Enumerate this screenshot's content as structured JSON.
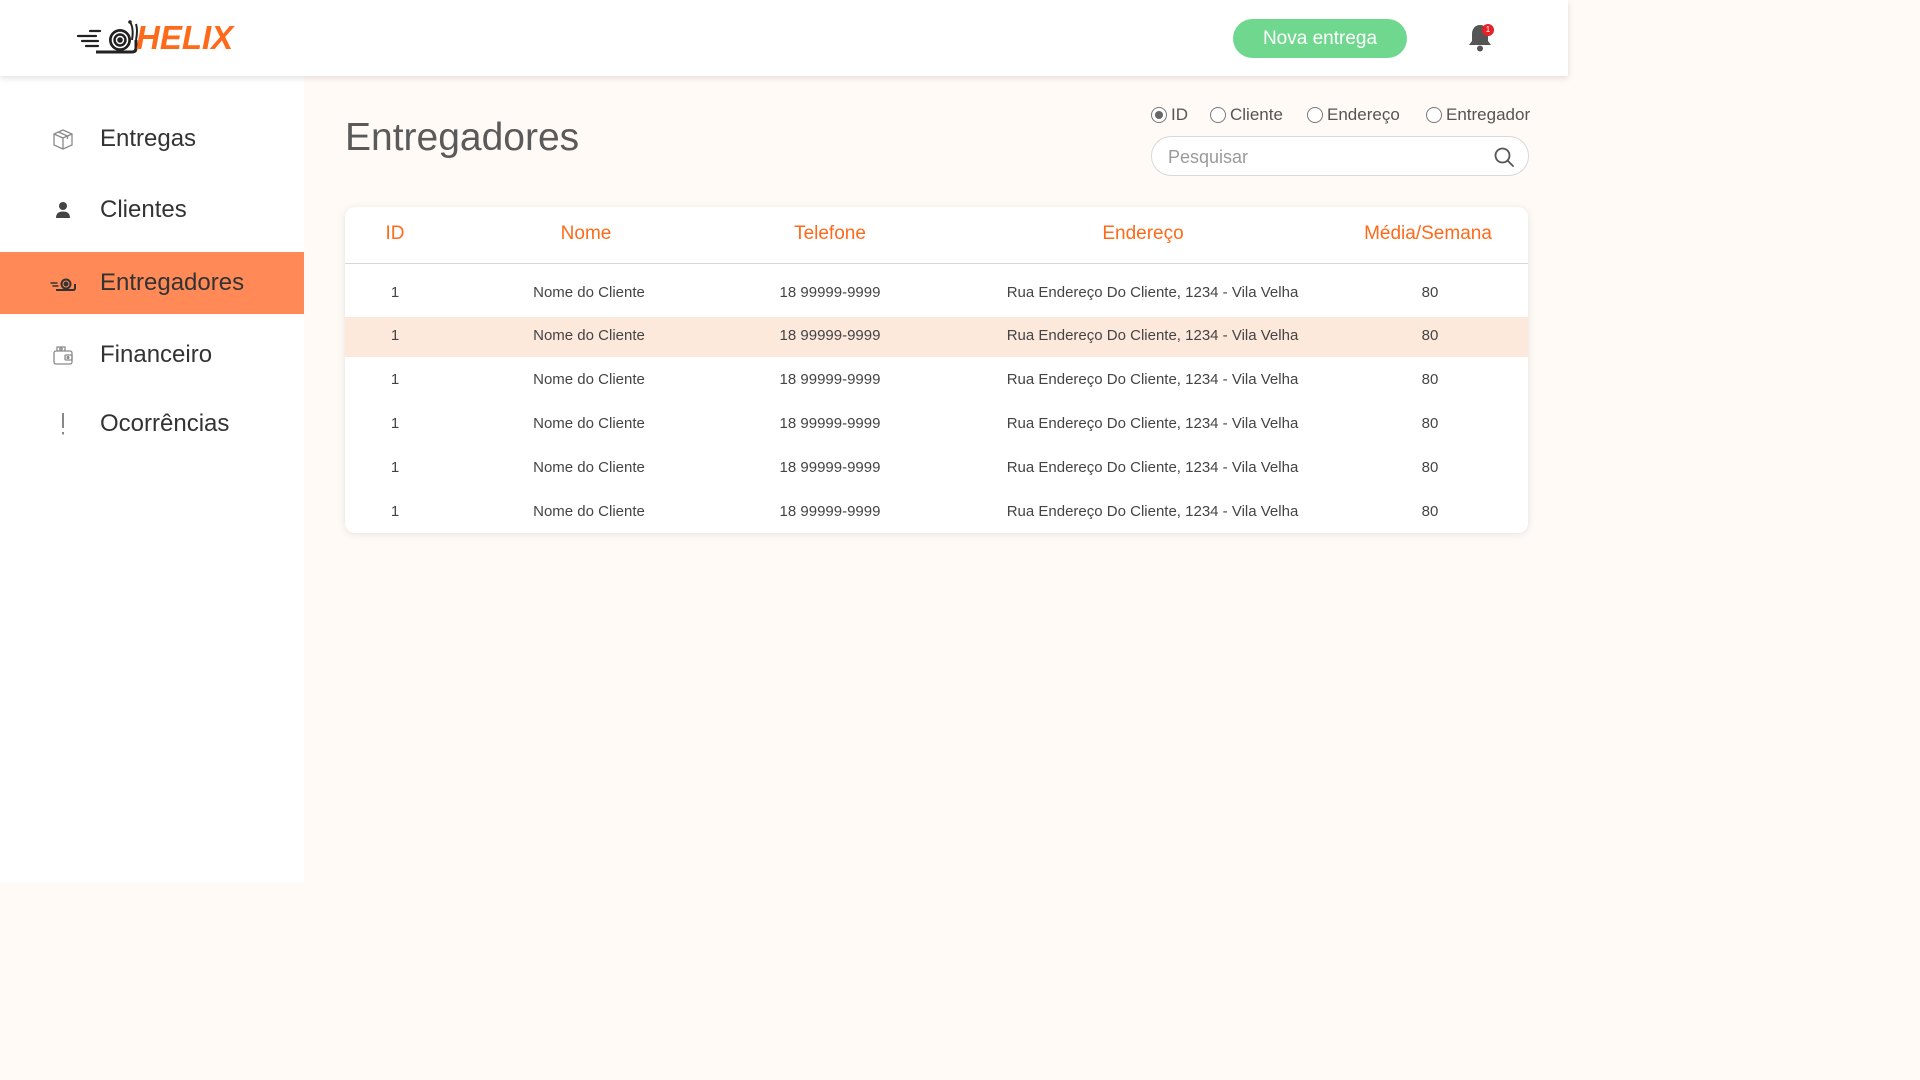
{
  "header": {
    "logo_text": "HELIX",
    "new_button_label": "Nova entrega",
    "notification_count": "1",
    "accent_color": "#ff6a1a",
    "button_color": "#6fd88e"
  },
  "sidebar": {
    "items": [
      {
        "label": "Entregas",
        "icon": "box-icon",
        "active": false
      },
      {
        "label": "Clientes",
        "icon": "person-icon",
        "active": false
      },
      {
        "label": "Entregadores",
        "icon": "snail-icon",
        "active": true
      },
      {
        "label": "Financeiro",
        "icon": "wallet-icon",
        "active": false
      },
      {
        "label": "Ocorrências",
        "icon": "exclamation-icon",
        "active": false
      }
    ],
    "active_color": "#ff8a57"
  },
  "main": {
    "title": "Entregadores",
    "filters": [
      {
        "label": "ID",
        "checked": true
      },
      {
        "label": "Cliente",
        "checked": false
      },
      {
        "label": "Endereço",
        "checked": false
      },
      {
        "label": "Entregador",
        "checked": false
      }
    ],
    "search": {
      "placeholder": "Pesquisar",
      "value": ""
    },
    "table": {
      "columns": [
        "ID",
        "Nome",
        "Telefone",
        "Endereço",
        "Média/Semana"
      ],
      "rows": [
        [
          "1",
          "Nome do Cliente",
          "18 99999-9999",
          "Rua Endereço Do Cliente, 1234 - Vila Velha",
          "80"
        ],
        [
          "1",
          "Nome do Cliente",
          "18 99999-9999",
          "Rua Endereço Do Cliente, 1234 - Vila Velha",
          "80"
        ],
        [
          "1",
          "Nome do Cliente",
          "18 99999-9999",
          "Rua Endereço Do Cliente, 1234 - Vila Velha",
          "80"
        ],
        [
          "1",
          "Nome do Cliente",
          "18 99999-9999",
          "Rua Endereço Do Cliente, 1234 - Vila Velha",
          "80"
        ],
        [
          "1",
          "Nome do Cliente",
          "18 99999-9999",
          "Rua Endereço Do Cliente, 1234 - Vila Velha",
          "80"
        ],
        [
          "1",
          "Nome do Cliente",
          "18 99999-9999",
          "Rua Endereço Do Cliente, 1234 - Vila Velha",
          "80"
        ]
      ],
      "highlighted_row": 1,
      "highlight_color": "#fde9dc"
    }
  }
}
